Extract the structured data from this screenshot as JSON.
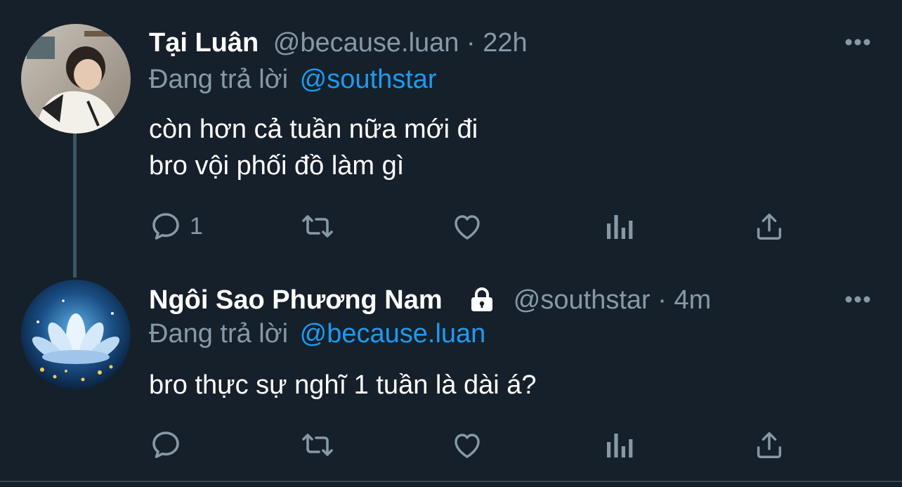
{
  "tweets": [
    {
      "display_name": "Tại Luân",
      "handle": "@because.luan",
      "separator": "·",
      "time": "22h",
      "reply_prefix": "Đang trả lời",
      "reply_to": "@southstar",
      "text_lines": [
        "còn hơn cả tuần nữa mới đi",
        "bro vội phối đồ làm gì"
      ],
      "reply_count": "1",
      "avatar_icon": "person-photo",
      "protected": false
    },
    {
      "display_name": "Ngôi Sao Phương Nam",
      "handle": "@southstar",
      "separator": "·",
      "time": "4m",
      "reply_prefix": "Đang trả lời",
      "reply_to": "@because.luan",
      "text_lines": [
        "bro thực sự nghĩ 1 tuần là dài á?"
      ],
      "reply_count": "",
      "avatar_icon": "lotus-image",
      "protected": true
    }
  ],
  "icons": {
    "reply": "reply-icon",
    "retweet": "retweet-icon",
    "like": "heart-icon",
    "analytics": "analytics-icon",
    "share": "share-icon",
    "more": "more-icon",
    "lock": "lock-icon"
  },
  "colors": {
    "background": "#15202b",
    "text": "#ffffff",
    "muted": "#8899a6",
    "accent": "#1d9bf0",
    "thread_line": "#3d5466"
  }
}
